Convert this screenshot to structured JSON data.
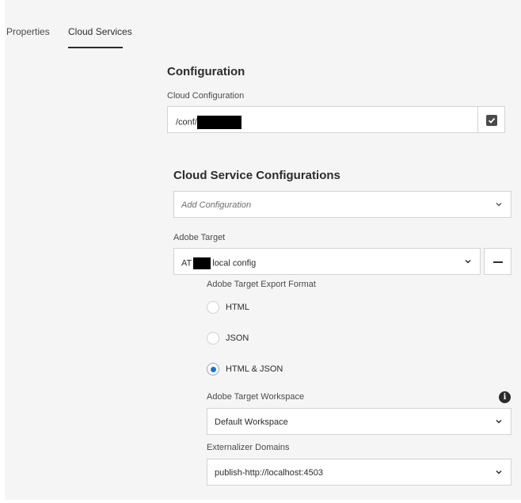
{
  "tabs": [
    {
      "label": "Properties",
      "active": false
    },
    {
      "label": "Cloud Services",
      "active": true
    }
  ],
  "configuration": {
    "heading": "Configuration",
    "cloud_configuration_label": "Cloud Configuration",
    "cloud_configuration_value_prefix": "/conf/"
  },
  "cloud_services": {
    "heading": "Cloud Service Configurations",
    "add_placeholder": "Add Configuration",
    "adobe_target_label": "Adobe Target",
    "adobe_target_value_prefix": "AT",
    "adobe_target_value_suffix": "local config",
    "export_format_label": "Adobe Target Export Format",
    "export_formats": [
      {
        "label": "HTML",
        "checked": false
      },
      {
        "label": "JSON",
        "checked": false
      },
      {
        "label": "HTML & JSON",
        "checked": true
      }
    ],
    "workspace_label": "Adobe Target Workspace",
    "workspace_value": "Default Workspace",
    "externalizer_label": "Externalizer Domains",
    "externalizer_value": "publish-http://localhost:4503"
  },
  "icons": {
    "checkbox": "check-icon",
    "chevron": "chevron-down-icon",
    "remove": "minus-icon",
    "info": "info-icon"
  },
  "colors": {
    "accent": "#1473e6",
    "panel_bg": "#f5f5f5",
    "text": "#2c2c2c"
  }
}
